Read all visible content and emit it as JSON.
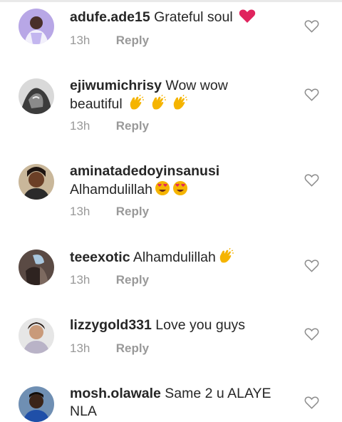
{
  "comments": [
    {
      "username": "adufe.ade15",
      "text": "Grateful soul",
      "emoji": [
        "red-heart"
      ],
      "time": "13h",
      "reply_label": "Reply"
    },
    {
      "username": "ejiwumichrisy",
      "text": "Wow wow beautiful",
      "emoji": [
        "clap",
        "clap",
        "clap"
      ],
      "time": "13h",
      "reply_label": "Reply"
    },
    {
      "username": "aminatadedoyinsanusi",
      "text": "Alhamdulillah",
      "emoji": [
        "heart-eyes",
        "heart-eyes"
      ],
      "time": "13h",
      "reply_label": "Reply"
    },
    {
      "username": "teeexotic",
      "text": "Alhamdulillah",
      "emoji": [
        "clap"
      ],
      "time": "13h",
      "reply_label": "Reply"
    },
    {
      "username": "lizzygold331",
      "text": "Love you guys",
      "emoji": [],
      "time": "13h",
      "reply_label": "Reply"
    },
    {
      "username": "mosh.olawale",
      "text": "Same 2 u ALAYE NLA",
      "emoji": [],
      "time": "",
      "reply_label": ""
    }
  ],
  "colors": {
    "text": "#262626",
    "meta": "#999999",
    "heart_outline": "#8e8e8e",
    "red": "#e0245e",
    "clap": "#f5b400"
  }
}
